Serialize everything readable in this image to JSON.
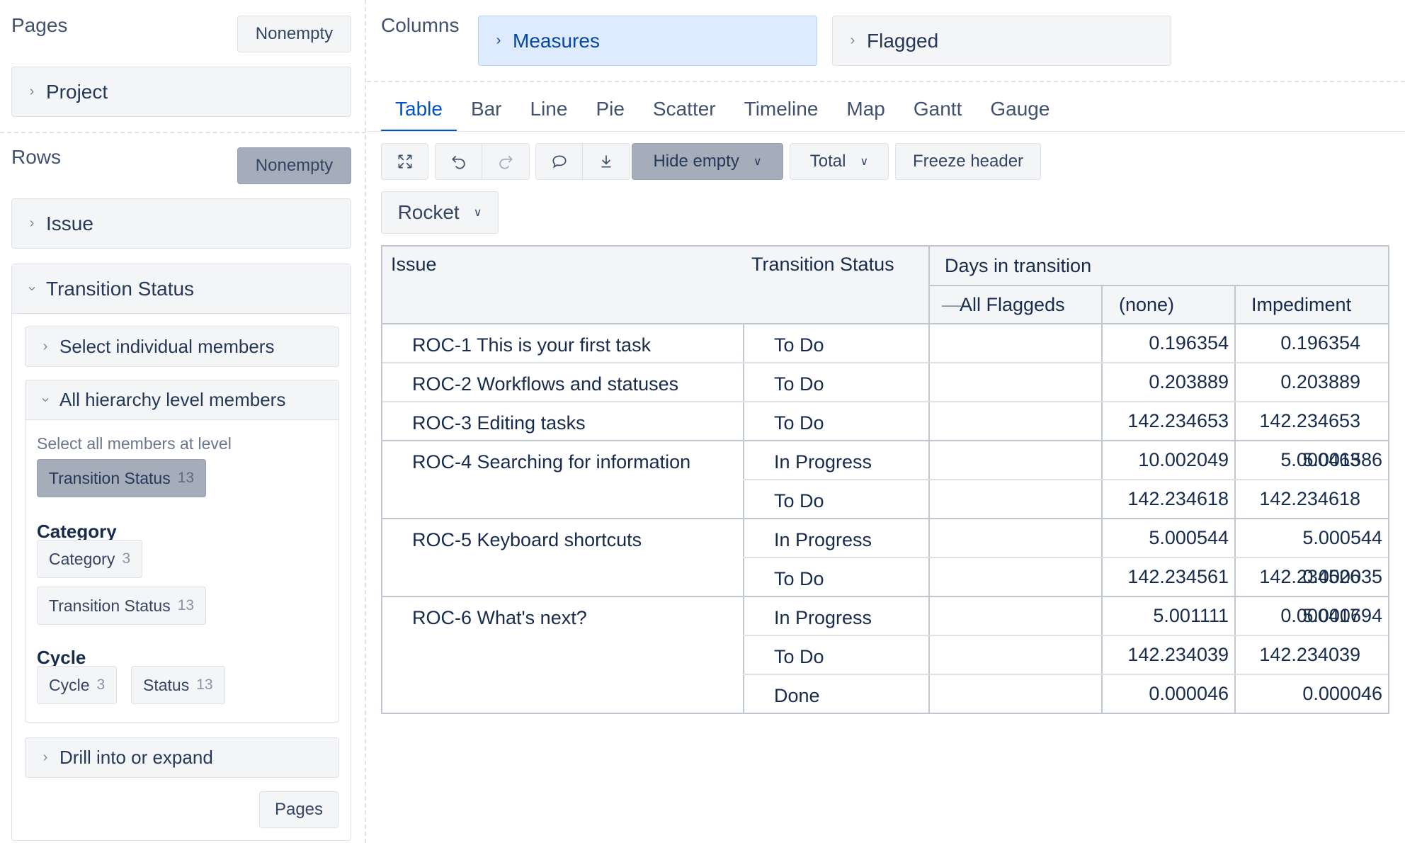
{
  "left": {
    "pages": {
      "title": "Pages",
      "nonempty": "Nonempty",
      "dimension": "Project"
    },
    "rows": {
      "title": "Rows",
      "nonempty": "Nonempty",
      "issue": "Issue",
      "transition_status": {
        "label": "Transition Status",
        "select_individual": "Select individual members",
        "all_hierarchy": "All hierarchy level members",
        "select_all_hint": "Select all members at level",
        "selected_level": {
          "label": "Transition Status",
          "count": "13"
        },
        "groups": [
          {
            "title": "Category",
            "chips": [
              {
                "label": "Category",
                "count": "3"
              },
              {
                "label": "Transition Status",
                "count": "13"
              }
            ]
          },
          {
            "title": "Cycle",
            "chips": [
              {
                "label": "Cycle",
                "count": "3"
              },
              {
                "label": "Status",
                "count": "13"
              }
            ]
          }
        ],
        "drill": "Drill into or expand",
        "pages_button": "Pages"
      }
    }
  },
  "columns": {
    "title": "Columns",
    "measures": "Measures",
    "flagged": "Flagged"
  },
  "tabs": [
    "Table",
    "Bar",
    "Line",
    "Pie",
    "Scatter",
    "Timeline",
    "Map",
    "Gantt",
    "Gauge"
  ],
  "active_tab": "Table",
  "toolbar": {
    "hide_empty": "Hide empty",
    "total": "Total",
    "freeze_header": "Freeze header",
    "project_select": "Rocket",
    "icons": [
      "fullscreen-icon",
      "undo-icon",
      "redo-icon",
      "comment-icon",
      "download-icon"
    ]
  },
  "table": {
    "headers": {
      "issue": "Issue",
      "transition_status": "Transition Status",
      "measure": "Days in transition",
      "all_flagged_toggle": "—",
      "all_flagged": "All Flaggeds",
      "none": "(none)",
      "impediment": "Impediment"
    },
    "rows": [
      {
        "issue": "ROC-1 This is your first task",
        "status": "To Do",
        "all": "0.196354",
        "none": "0.196354",
        "imp": ""
      },
      {
        "issue": "ROC-2 Workflows and statuses",
        "status": "To Do",
        "all": "0.203889",
        "none": "0.203889",
        "imp": ""
      },
      {
        "issue": "ROC-3 Editing tasks",
        "status": "To Do",
        "all": "142.234653",
        "none": "142.234653",
        "imp": ""
      },
      {
        "issue": "ROC-4 Searching for information",
        "status": "In Progress",
        "all": "10.002049",
        "none": "5.000463",
        "imp": "5.001586"
      },
      {
        "issue": "",
        "status": "To Do",
        "all": "142.234618",
        "none": "142.234618",
        "imp": ""
      },
      {
        "issue": "ROC-5 Keyboard shortcuts",
        "status": "In Progress",
        "all": "5.000544",
        "none": "",
        "imp": "5.000544"
      },
      {
        "issue": "",
        "status": "To Do",
        "all": "142.234561",
        "none": "142.234526",
        "imp": "0.000035"
      },
      {
        "issue": "ROC-6 What's next?",
        "status": "In Progress",
        "all": "5.001111",
        "none": "0.000417",
        "imp": "5.000694"
      },
      {
        "issue": "",
        "status": "To Do",
        "all": "142.234039",
        "none": "142.234039",
        "imp": ""
      },
      {
        "issue": "",
        "status": "Done",
        "all": "0.000046",
        "none": "",
        "imp": "0.000046"
      }
    ]
  }
}
